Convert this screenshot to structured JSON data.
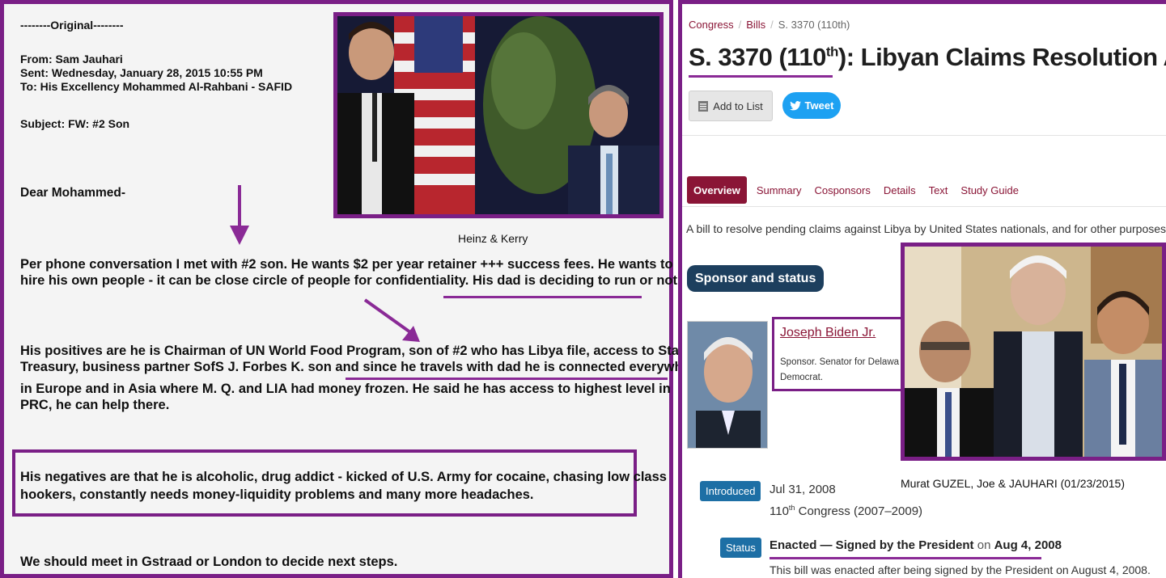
{
  "email": {
    "original_marker": "--------Original--------",
    "from": "From: Sam Jauhari",
    "sent": "Sent: Wednesday, January 28, 2015 10:55 PM",
    "to": "To: His Excellency Mohammed Al-Rahbani - SAFID",
    "subject": "Subject: FW: #2 Son",
    "greeting": "Dear Mohammed-",
    "p1_line1": "Per phone conversation I met with #2 son. He wants $2 per year retainer +++ success fees. He wants to",
    "p1_line2_a": "hire his own people - it can be close circle of people for confidentiality.",
    "p1_line2_b": "His dad is deciding to run or not.",
    "p2_line1": "His positives are he is Chairman of UN World Food Program, son of #2 who has Libya file, access to State,",
    "p2_line2_a": "Treasury, business partner SofS J. Forbes K. son and",
    "p2_line2_b": "since he travels with dad he is connected everywhere",
    "p2_line3": "in Europe and in Asia where M. Q. and LIA had money frozen. He said he has access to highest level in",
    "p2_line4": "PRC, he can help there.",
    "p3_line1": "His negatives are that he is alcoholic, drug addict - kicked of U.S. Army for cocaine, chasing low class",
    "p3_line2": "hookers, constantly needs money-liquidity problems and many more headaches.",
    "closing": "We should meet in Gstraad or London to decide next steps."
  },
  "photo_caption_1": "Heinz & Kerry",
  "congress": {
    "breadcrumb": [
      "Congress",
      "Bills",
      "S. 3370 (110th)"
    ],
    "title_pre": "S. 3370 (110",
    "title_sup": "th",
    "title_post": "): Libyan Claims Resolution Act",
    "add_to_list": "Add to List",
    "tweet": "Tweet",
    "tabs": [
      "Overview",
      "Summary",
      "Cosponsors",
      "Details",
      "Text",
      "Study Guide"
    ],
    "summary": "A bill to resolve pending claims against Libya by United States nationals, and for other purposes",
    "section_sponsor": "Sponsor and status",
    "sponsor_name": "Joseph Biden Jr.",
    "sponsor_line1": "Sponsor. Senator for Delawa",
    "sponsor_line2": "Democrat.",
    "introduced_label": "Introduced",
    "introduced_date": "Jul 31, 2008",
    "congress_pre": "110",
    "congress_sup": "th",
    "congress_post": " Congress (2007–2009)",
    "status_label": "Status",
    "status_bold": "Enacted — Signed by the President",
    "status_on": " on ",
    "status_date": "Aug 4, 2008",
    "status_note": "This bill was enacted after being signed by the President on August 4, 2008."
  },
  "photo_caption_2": "Murat GUZEL, Joe & JAUHARI (01/23/2015)",
  "colors": {
    "frame_purple": "#7a1f86",
    "congress_maroon": "#8a1536",
    "navy": "#1d3f5e",
    "twitter_blue": "#1da1f2"
  },
  "icons": [
    "down-arrow-icon",
    "diagonal-arrow-icon",
    "list-icon",
    "twitter-bird-icon"
  ]
}
